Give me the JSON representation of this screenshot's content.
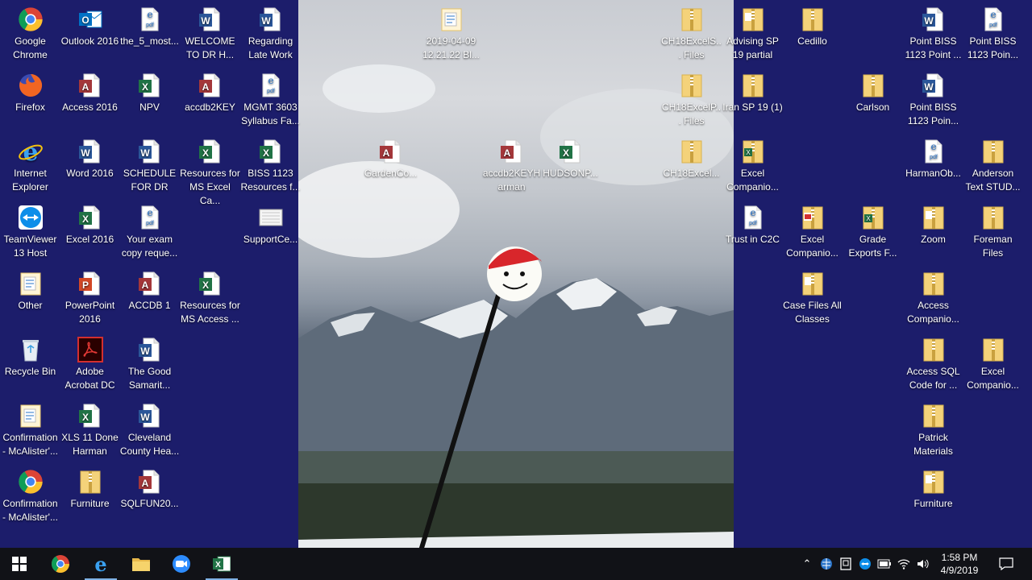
{
  "desktop_icons": [
    {
      "name": "Google Chrome",
      "type": "chrome"
    },
    {
      "name": "Outlook 2016",
      "type": "outlook"
    },
    {
      "name": "the_5_most...",
      "type": "pdf"
    },
    {
      "name": "WELCOME TO DR H...",
      "type": "word"
    },
    {
      "name": "Regarding Late Work",
      "type": "word"
    },
    {
      "name": "Firefox",
      "type": "firefox"
    },
    {
      "name": "Access 2016",
      "type": "access"
    },
    {
      "name": "NPV",
      "type": "excel"
    },
    {
      "name": "accdb2KEY",
      "type": "access-file"
    },
    {
      "name": "MGMT 3603 Syllabus Fa...",
      "type": "pdf"
    },
    {
      "name": "Internet Explorer",
      "type": "ie"
    },
    {
      "name": "Word 2016",
      "type": "word-app"
    },
    {
      "name": "SCHEDULE FOR DR",
      "type": "word"
    },
    {
      "name": "Resources for MS Excel Ca...",
      "type": "excel"
    },
    {
      "name": "BISS 1123 Resources f...",
      "type": "excel"
    },
    {
      "name": "TeamViewer 13 Host",
      "type": "teamviewer"
    },
    {
      "name": "Excel 2016",
      "type": "excel-app"
    },
    {
      "name": "Your exam copy reque...",
      "type": "pdf"
    },
    {
      "name": "SupportCe...",
      "type": "generic"
    },
    {
      "name": "Other",
      "type": "folder-doc"
    },
    {
      "name": "PowerPoint 2016",
      "type": "powerpoint"
    },
    {
      "name": "ACCDB 1",
      "type": "access-file"
    },
    {
      "name": "Resources for MS Access ...",
      "type": "excel"
    },
    {
      "name": "Recycle Bin",
      "type": "recycle"
    },
    {
      "name": "Adobe Acrobat DC",
      "type": "acrobat"
    },
    {
      "name": "The Good Samarit...",
      "type": "word"
    },
    {
      "name": "Confirmation - McAlister'...",
      "type": "folder-doc"
    },
    {
      "name": "XLS 11 Done Harman",
      "type": "excel"
    },
    {
      "name": "Cleveland County Hea...",
      "type": "word"
    },
    {
      "name": "Confirmation - McAlister'...",
      "type": "chrome"
    },
    {
      "name": "Furniture",
      "type": "zip"
    },
    {
      "name": "SQLFUN20...",
      "type": "access-file"
    },
    {
      "name": "2019-04-09 12.21.22 Bl...",
      "type": "folder-doc"
    },
    {
      "name": "GardenCo...",
      "type": "access-file"
    },
    {
      "name": "accdb2KEYHarman",
      "type": "access-file"
    },
    {
      "name": "HUDSONP...",
      "type": "excel"
    },
    {
      "name": "CH18ExcelS... Files",
      "type": "zip"
    },
    {
      "name": "CH18ExcelP... Files",
      "type": "zip"
    },
    {
      "name": "CH18Excel...",
      "type": "zip"
    },
    {
      "name": "Advising SP 19 partial",
      "type": "zip-doc"
    },
    {
      "name": "Cedillo",
      "type": "zip"
    },
    {
      "name": "Point BISS 1123 Point ...",
      "type": "word"
    },
    {
      "name": "Point BISS 1123 Poin...",
      "type": "pdf"
    },
    {
      "name": "Iran SP 19 (1)",
      "type": "zip"
    },
    {
      "name": "Carlson",
      "type": "zip"
    },
    {
      "name": "Point BISS 1123 Poin...",
      "type": "word"
    },
    {
      "name": "Excel Companio...",
      "type": "zip-excel"
    },
    {
      "name": "HarmanOb...",
      "type": "pdf"
    },
    {
      "name": "Anderson Text STUD...",
      "type": "zip"
    },
    {
      "name": "Trust in C2C",
      "type": "pdf"
    },
    {
      "name": "Excel Companio...",
      "type": "zip-pdf"
    },
    {
      "name": "Grade Exports F...",
      "type": "zip-excel"
    },
    {
      "name": "Zoom",
      "type": "zip-doc"
    },
    {
      "name": "Foreman Files",
      "type": "zip"
    },
    {
      "name": "Case Files All Classes",
      "type": "zip-doc"
    },
    {
      "name": "Access Companio...",
      "type": "zip"
    },
    {
      "name": "Access SQL Code for ...",
      "type": "zip"
    },
    {
      "name": "Excel Companio...",
      "type": "zip"
    },
    {
      "name": "Patrick Materials",
      "type": "zip"
    },
    {
      "name": "Furniture",
      "type": "zip-doc"
    }
  ],
  "taskbar": {
    "pinned": [
      {
        "name": "start",
        "icon": "windows-logo"
      },
      {
        "name": "chrome",
        "icon": "chrome-icon"
      },
      {
        "name": "internet-explorer",
        "icon": "ie-icon",
        "active": true
      },
      {
        "name": "file-explorer",
        "icon": "folder-icon"
      },
      {
        "name": "zoom",
        "icon": "zoom-icon"
      },
      {
        "name": "excel",
        "icon": "excel-icon",
        "active": true
      }
    ],
    "tray": [
      "chevron-up-icon",
      "globe-icon",
      "tablet-icon",
      "teamviewer-icon",
      "battery-icon",
      "wifi-icon",
      "volume-icon"
    ],
    "time": "1:58 PM",
    "date": "4/9/2019",
    "notification_icon": "action-center-icon"
  },
  "colors": {
    "desktop_bg": "#1c1d6b",
    "taskbar_bg": "#111217",
    "word": "#2b579a",
    "excel": "#217346",
    "access": "#a4373a",
    "pdf": "#2a74c9",
    "zip": "#e7c25a"
  }
}
